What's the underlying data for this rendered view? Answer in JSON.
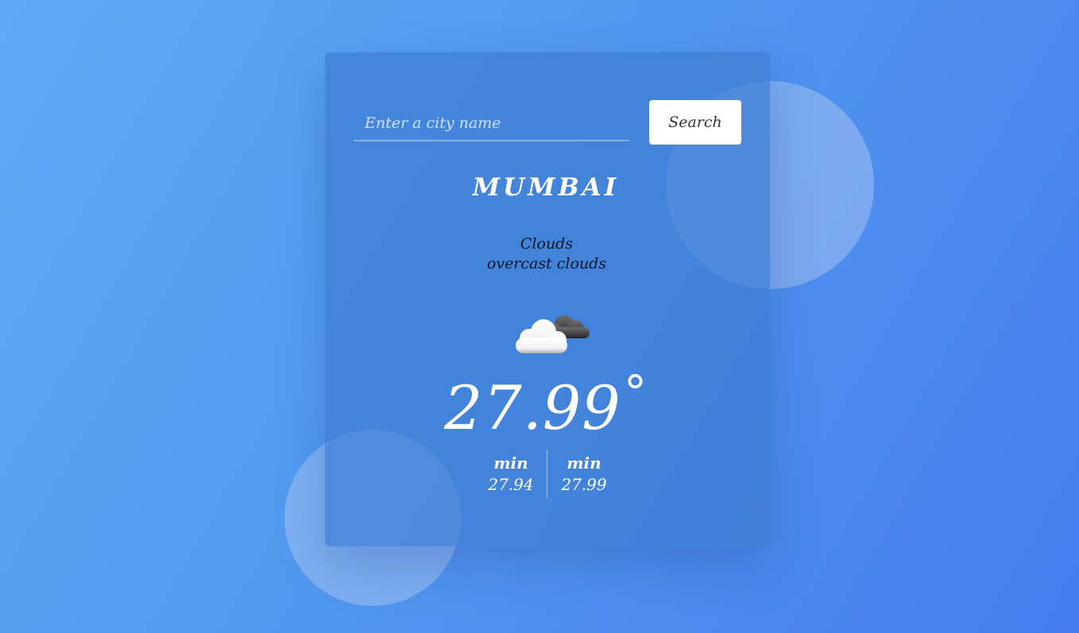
{
  "search": {
    "placeholder": "Enter a city name",
    "value": "",
    "button_label": "Search"
  },
  "weather": {
    "city": "MUMBAI",
    "main": "Clouds",
    "description": "overcast clouds",
    "icon": "overcast-clouds-icon",
    "temperature": "27.99",
    "degree_symbol": "°",
    "min_label_1": "min",
    "min_value_1": "27.94",
    "min_label_2": "min",
    "min_value_2": "27.99"
  },
  "colors": {
    "background_start": "#5eaaf5",
    "background_end": "#467ced",
    "card": "#3e7dd2",
    "text": "#ffffff",
    "description_text": "#0d1524",
    "button_bg": "#ffffff"
  }
}
